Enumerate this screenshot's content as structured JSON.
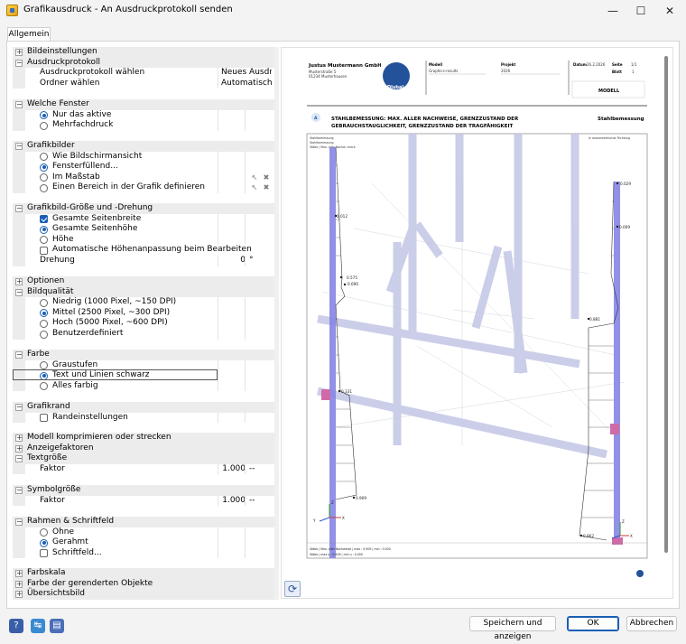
{
  "window": {
    "title": "Grafikausdruck - An Ausdruckprotokoll senden",
    "minimize": "—",
    "maximize": "☐",
    "close": "✕"
  },
  "tabs": [
    {
      "label": "Allgemein"
    }
  ],
  "tree": {
    "bildeinstellungen": "Bildeinstellungen",
    "ausdruckprotokoll": {
      "title": "Ausdruckprotokoll",
      "waehlen_label": "Ausdruckprotokoll wählen",
      "waehlen_value": "Neues Ausdr...",
      "ordner_label": "Ordner wählen",
      "ordner_value": "Automatisch"
    },
    "welche_fenster": {
      "title": "Welche Fenster",
      "nur_aktive": "Nur das aktive",
      "mehrfach": "Mehrfachdruck"
    },
    "grafikbilder": {
      "title": "Grafikbilder",
      "wie_bildschirm": "Wie Bildschirmansicht",
      "fensterfuellend": "Fensterfüllend...",
      "massstab": "Im Maßstab",
      "bereich": "Einen Bereich in der Grafik definieren"
    },
    "groesse": {
      "title": "Grafikbild-Größe und -Drehung",
      "seitenbreite": "Gesamte Seitenbreite",
      "seitenhoehe": "Gesamte Seitenhöhe",
      "hoehe": "Höhe",
      "auto_hoehe": "Automatische Höhenanpassung beim Bearbeiten",
      "drehung_label": "Drehung",
      "drehung_value": "0",
      "drehung_unit": "°"
    },
    "optionen": "Optionen",
    "bildqualitaet": {
      "title": "Bildqualität",
      "niedrig": "Niedrig (1000 Pixel, ~150 DPI)",
      "mittel": "Mittel (2500 Pixel, ~300 DPI)",
      "hoch": "Hoch (5000 Pixel, ~600 DPI)",
      "benutzer": "Benutzerdefiniert"
    },
    "farbe": {
      "title": "Farbe",
      "graustufen": "Graustufen",
      "schwarz": "Text und Linien schwarz",
      "farbig": "Alles farbig"
    },
    "grafikrand": {
      "title": "Grafikrand",
      "rand": "Randeinstellungen"
    },
    "modell_komprimieren": "Modell komprimieren oder strecken",
    "anzeigefaktoren": "Anzeigefaktoren",
    "textgroesse": {
      "title": "Textgröße",
      "faktor_label": "Faktor",
      "faktor_value": "1.000",
      "faktor_unit": "--"
    },
    "symbolgroesse": {
      "title": "Symbolgröße",
      "faktor_label": "Faktor",
      "faktor_value": "1.000",
      "faktor_unit": "--"
    },
    "rahmen": {
      "title": "Rahmen & Schriftfeld",
      "ohne": "Ohne",
      "gerahmt": "Gerahmt",
      "schriftfeld": "Schriftfeld..."
    },
    "farbskala": "Farbskala",
    "farbe_objekte": "Farbe der gerenderten Objekte",
    "uebersichtsbild": "Übersichtsbild"
  },
  "preview": {
    "company": "Justus Mustermann GmbH",
    "street": "Musterstraße 5",
    "city": "01234 Musterhausen",
    "modell_label": "Modell",
    "modell_value": "Graphics-results",
    "projekt_label": "Projekt",
    "projekt_value": "2026",
    "datum_label": "Datum",
    "datum_value": "26.2.2026",
    "seite_label": "Seite",
    "seite_value": "1/1",
    "blatt_label": "Blatt",
    "blatt_value": "1",
    "box_label": "MODELL",
    "logo": "Dlubal",
    "section_letter": "A",
    "heading_line1": "STAHLBEMESSUNG: MAX. ALLER NACHWEISE, GRENZZUSTAND DER",
    "heading_line2": "GEBRAUCHSTAUGLICHKEIT, GRENZZUSTAND DER TRAGFÄHIGKEIT",
    "heading_right": "Stahlbemessung",
    "legend1": "Stahlbemessung",
    "legend2": "Stahlbemessung",
    "legend3": "Stäbe | Max. aller Nachw. check",
    "view_label": "In axonometrischer Richtung",
    "labels": {
      "v0012": "0.012",
      "v0575": "0.575",
      "v0690": "0.690",
      "v0331": "0.331",
      "v0909a": "0.909",
      "v0029": "0.029",
      "v0009": "0.009",
      "v0881": "0.881",
      "v0862": "0.862"
    },
    "footer1": "Stäbe | Max. aller Nachweise | max : 0.909 | min : 0.000",
    "footer2": "Stäbe | max η : 0.909 | min η : 0.000",
    "axis_x": "X",
    "axis_y": "Y",
    "axis_z": "Z",
    "colors": {
      "member": "#7b7be0",
      "grid": "#c8cce8",
      "accent": "#1a5fb4"
    }
  },
  "footer_buttons": {
    "save_show": "Speichern und anzeigen",
    "ok": "OK",
    "cancel": "Abbrechen"
  },
  "icons": {
    "help": "help-icon",
    "units": "units-icon",
    "settings": "settings-icon",
    "refresh": "refresh-icon"
  }
}
